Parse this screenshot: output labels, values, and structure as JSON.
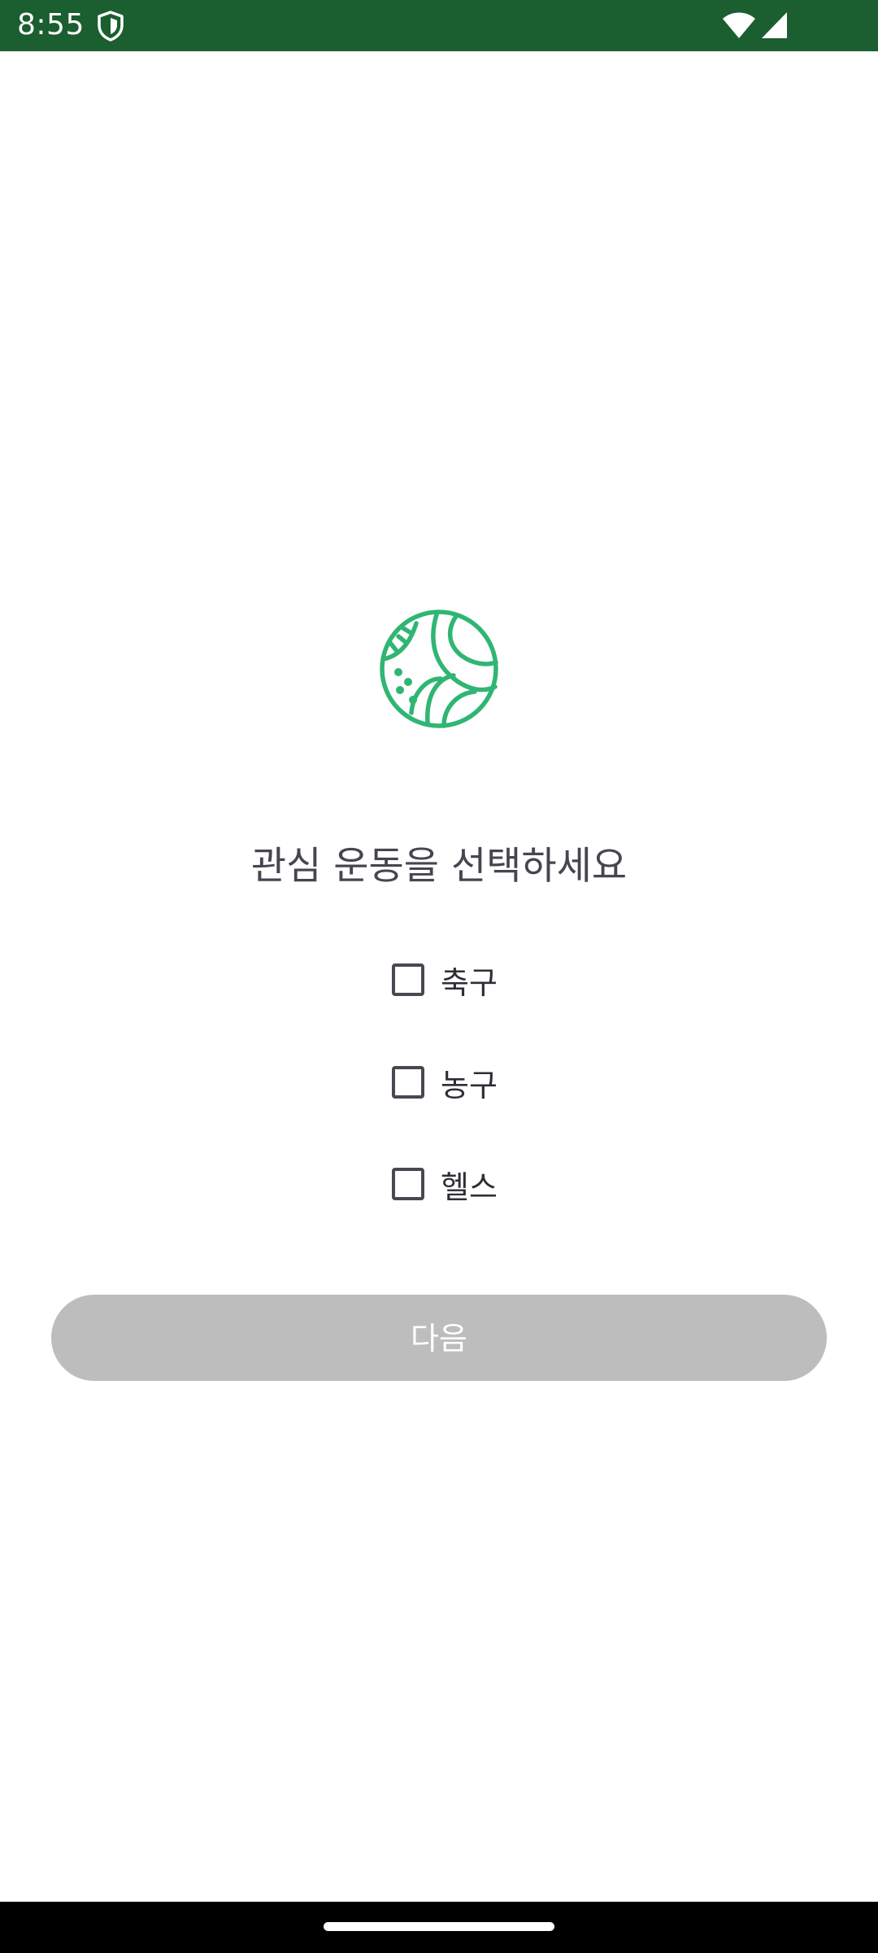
{
  "status_bar": {
    "time": "8:55",
    "icons": [
      "shield-icon",
      "wifi-icon",
      "signal-icon"
    ],
    "background": "#1b5e2f"
  },
  "logo": {
    "icon": "sports-ball-icon",
    "color": "#2fb673"
  },
  "title": "관심 운동을 선택하세요",
  "options": [
    {
      "label": "축구",
      "checked": false
    },
    {
      "label": "농구",
      "checked": false
    },
    {
      "label": "헬스",
      "checked": false
    }
  ],
  "next_button": {
    "label": "다음",
    "enabled": false,
    "background": "#bdbdbd"
  }
}
